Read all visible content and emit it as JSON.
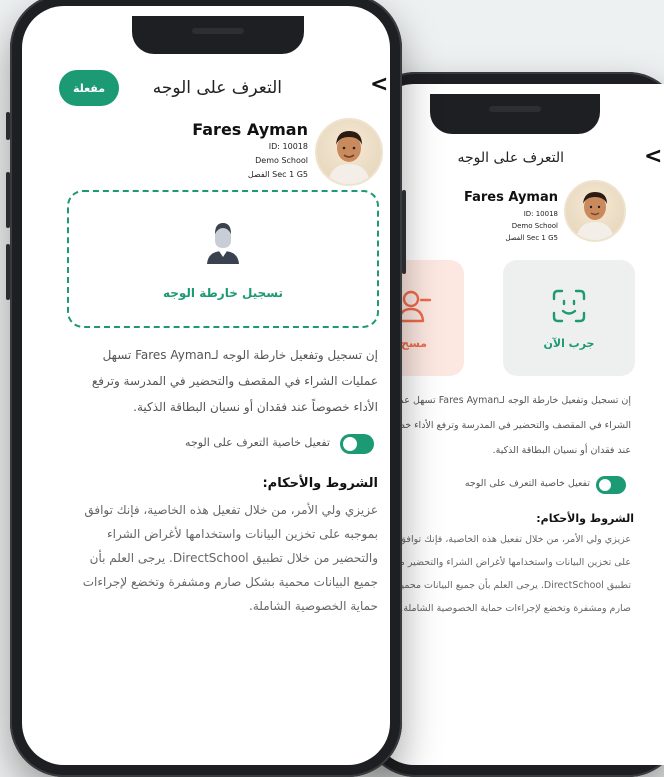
{
  "front": {
    "status_badge": "مفعلة",
    "header_title": "التعرف على الوجه",
    "student": {
      "name": "Fares Ayman",
      "id": "ID: 10018",
      "school": "Demo School",
      "class": "Sec 1 G5  الفصل"
    },
    "register_label": "تسجيل خارطة الوجه",
    "description": "إن تسجيل وتفعيل خارطة الوجه لـFares Ayman تسهل عمليات الشراء في المقصف والتحضير في المدرسة وترفع الأداء خصوصاً عند فقدان أو نسيان البطاقة الذكية.",
    "toggle_label": "تفعيل خاصية التعرف على الوجه",
    "toggle_on": true,
    "terms_title": "الشروط والأحكام:",
    "terms_text": "عزيزي ولي الأمر، من خلال تفعيل هذه الخاصية، فإنك توافق بموجبه على تخزين البيانات واستخدامها لأغراض الشراء والتحضير من خلال تطبيق DirectSchool. يرجى العلم بأن جميع البيانات محمية بشكل صارم ومشفرة وتخضع لإجراءات حماية الخصوصية الشاملة."
  },
  "back": {
    "header_title": "التعرف على الوجه",
    "student": {
      "name": "Fares Ayman",
      "id": "ID: 10018",
      "school": "Demo School",
      "class": "Sec 1 G5  الفصل"
    },
    "try_now_label": "جرب الآن",
    "delete_label": "مسح",
    "description": "إن تسجيل وتفعيل خارطة الوجه لـFares Ayman تسهل عمليات الشراء في المقصف والتحضير في المدرسة وترفع الأداء خصوصاً عند فقدان أو نسيان البطاقة الذكية.",
    "toggle_label": "تفعيل خاصية التعرف على الوجه",
    "terms_title": "الشروط والأحكام:",
    "terms_text": "عزيزي ولي الأمر، من خلال تفعيل هذه الخاصية، فإنك توافق بموجبه على تخزين البيانات واستخدامها لأغراض الشراء والتحضير من خلال تطبيق DirectSchool. يرجى العلم بأن جميع البيانات محمية بشكل صارم ومشفرة وتخضع لإجراءات حماية الخصوصية الشاملة."
  },
  "colors": {
    "brand_green": "#1c9a73",
    "delete_tile_bg": "#fde8e1",
    "delete_accent": "#ef6a4a",
    "try_tile_bg": "#eef0ef"
  },
  "icons": {
    "back": "chevron-left-icon",
    "face_scan": "face-scan-icon",
    "remove_user": "user-minus-icon",
    "person": "person-silhouette-icon"
  }
}
